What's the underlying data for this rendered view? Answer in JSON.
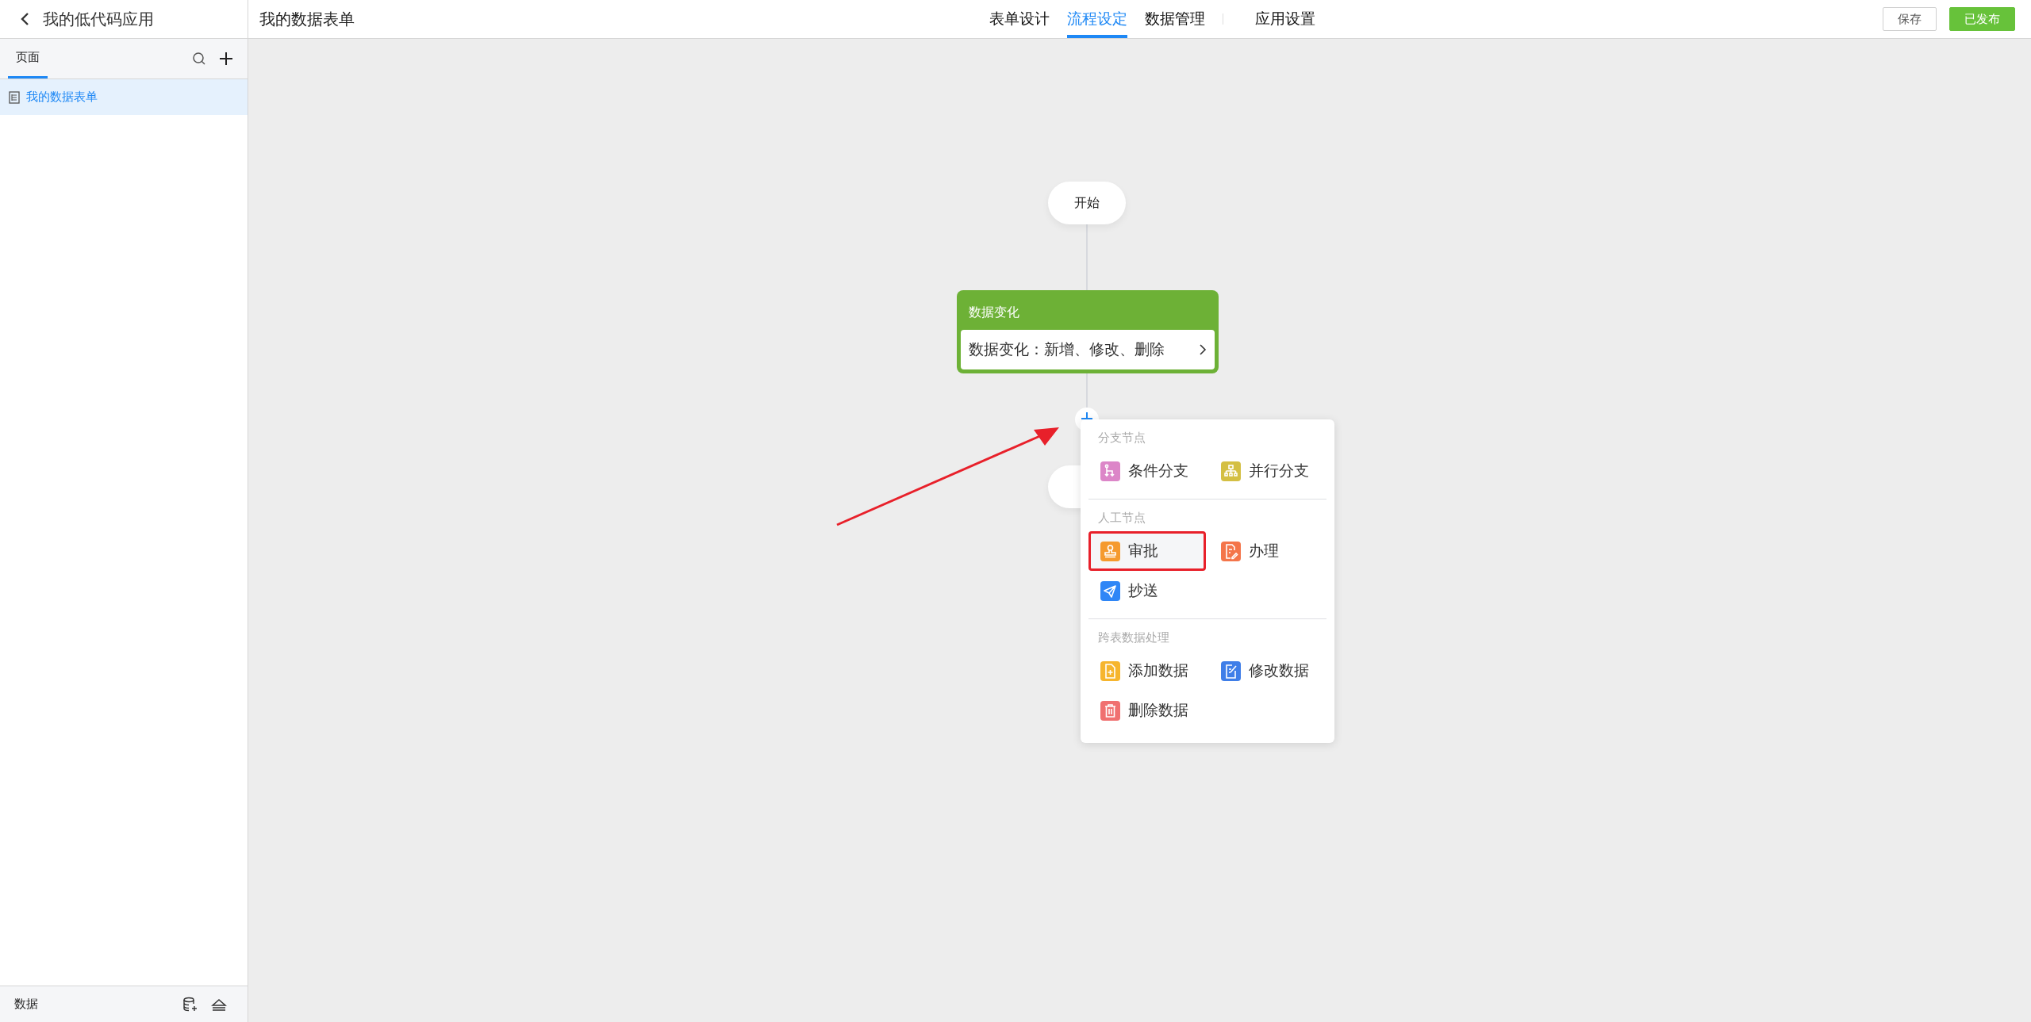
{
  "sidebar": {
    "app_title": "我的低代码应用",
    "tabs": [
      {
        "label": "页面",
        "selected": true
      }
    ],
    "items": [
      {
        "label": "我的数据表单",
        "selected": true
      }
    ],
    "footer_label": "数据"
  },
  "header": {
    "title": "我的数据表单",
    "tabs": [
      {
        "label": "表单设计",
        "selected": false
      },
      {
        "label": "流程设定",
        "selected": true
      },
      {
        "label": "数据管理",
        "selected": false
      },
      {
        "label": "应用设置",
        "selected": false
      }
    ],
    "buttons": [
      {
        "label": "保存",
        "kind": "secondary"
      },
      {
        "label": "已发布",
        "kind": "primary"
      }
    ]
  },
  "flow": {
    "start": "开始",
    "trigger": {
      "title": "数据变化",
      "summary": "数据变化：新增、修改、删除"
    }
  },
  "menu": {
    "sections": [
      {
        "title": "分支节点",
        "items": [
          {
            "label": "条件分支",
            "kind": "branch",
            "color": "#dc86c8",
            "highlighted": false
          },
          {
            "label": "并行分支",
            "kind": "parallel",
            "color": "#d4bf43",
            "highlighted": false
          }
        ]
      },
      {
        "title": "人工节点",
        "items": [
          {
            "label": "审批",
            "kind": "stamp",
            "color": "#f59a2e",
            "highlighted": true
          },
          {
            "label": "办理",
            "kind": "handle",
            "color": "#f4754a",
            "highlighted": false
          },
          {
            "label": "抄送",
            "kind": "send",
            "color": "#2f86f6",
            "highlighted": false
          }
        ]
      },
      {
        "title": "跨表数据处理",
        "items": [
          {
            "label": "添加数据",
            "kind": "add",
            "color": "#f6b52e",
            "highlighted": false
          },
          {
            "label": "修改数据",
            "kind": "edit",
            "color": "#3f7ee8",
            "highlighted": false
          },
          {
            "label": "删除数据",
            "kind": "delete",
            "color": "#f07070",
            "highlighted": false
          }
        ]
      }
    ]
  }
}
